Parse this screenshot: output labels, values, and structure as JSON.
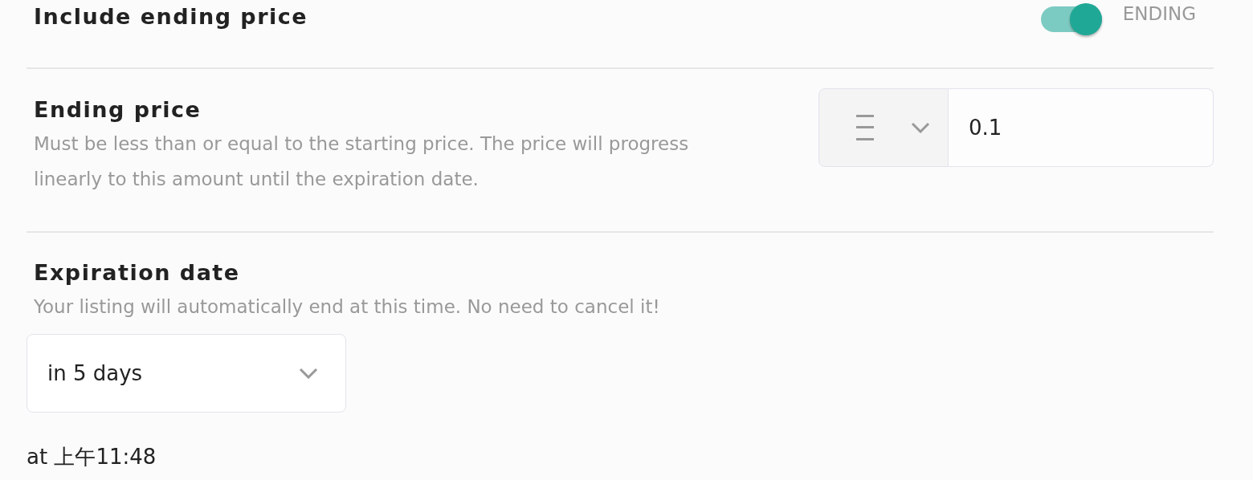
{
  "ending_toggle": {
    "title": "Include ending price",
    "on": true,
    "label": "ENDING"
  },
  "ending_price": {
    "title": "Ending price",
    "description": "Must be less than or equal to the starting price. The price will progress linearly to this amount until the expiration date.",
    "value": "0.1"
  },
  "expiration": {
    "title": "Expiration date",
    "description": "Your listing will automatically end at this time. No need to cancel it!",
    "selected_option": "in 5 days",
    "time": "at 上午11:48"
  }
}
